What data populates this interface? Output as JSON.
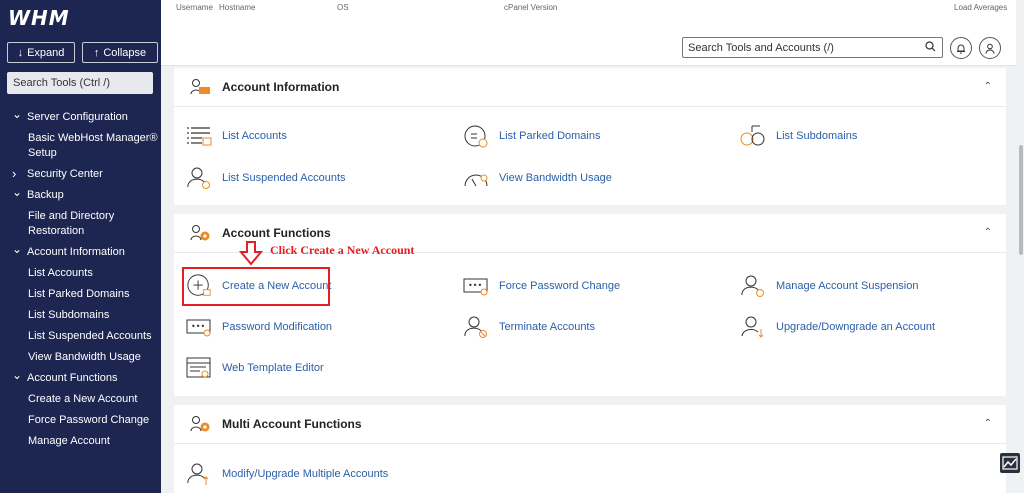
{
  "sidebar": {
    "logo": "WHM",
    "expand_label": "Expand",
    "collapse_label": "Collapse",
    "search_placeholder": "Search Tools (Ctrl /)",
    "items": [
      {
        "type": "cat",
        "label": "Server Configuration",
        "chevron": "down"
      },
      {
        "type": "sub",
        "label": "Basic WebHost Manager® Setup"
      },
      {
        "type": "cat",
        "label": "Security Center",
        "chevron": "right"
      },
      {
        "type": "cat",
        "label": "Backup",
        "chevron": "down"
      },
      {
        "type": "sub",
        "label": "File and Directory Restoration"
      },
      {
        "type": "cat",
        "label": "Account Information",
        "chevron": "down"
      },
      {
        "type": "sub",
        "label": "List Accounts"
      },
      {
        "type": "sub",
        "label": "List Parked Domains"
      },
      {
        "type": "sub",
        "label": "List Subdomains"
      },
      {
        "type": "sub",
        "label": "List Suspended Accounts"
      },
      {
        "type": "sub",
        "label": "View Bandwidth Usage"
      },
      {
        "type": "cat",
        "label": "Account Functions",
        "chevron": "down"
      },
      {
        "type": "sub",
        "label": "Create a New Account"
      },
      {
        "type": "sub",
        "label": "Force Password Change"
      },
      {
        "type": "sub",
        "label": "Manage Account"
      }
    ]
  },
  "topbar": {
    "stats": {
      "username": "Username",
      "hostname": "Hostname",
      "os": "OS",
      "cpanel_version": "cPanel Version",
      "load_averages": "Load Averages"
    },
    "search_placeholder": "Search Tools and Accounts (/)"
  },
  "panels": {
    "account_information": {
      "title": "Account Information",
      "items": {
        "list_accounts": "List Accounts",
        "list_parked_domains": "List Parked Domains",
        "list_subdomains": "List Subdomains",
        "list_suspended_accounts": "List Suspended Accounts",
        "view_bandwidth_usage": "View Bandwidth Usage"
      }
    },
    "account_functions": {
      "title": "Account Functions",
      "items": {
        "create_new_account": "Create a New Account",
        "force_password_change": "Force Password Change",
        "manage_account_suspension": "Manage Account Suspension",
        "password_modification": "Password Modification",
        "terminate_accounts": "Terminate Accounts",
        "upgrade_downgrade": "Upgrade/Downgrade an Account",
        "web_template_editor": "Web Template Editor"
      }
    },
    "multi_account_functions": {
      "title": "Multi Account Functions",
      "items": {
        "modify_upgrade_multiple": "Modify/Upgrade Multiple Accounts"
      }
    }
  },
  "annotation": {
    "text": "Click Create a New Account"
  },
  "colors": {
    "sidebar_bg": "#1d2651",
    "accent_orange": "#f08a24",
    "link_blue": "#2a5fa8",
    "highlight_red": "#e31e24"
  }
}
